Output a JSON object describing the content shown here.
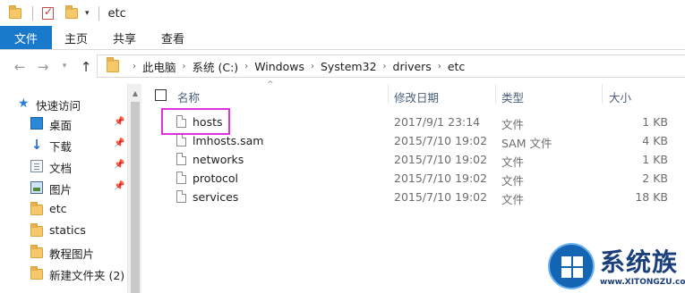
{
  "window": {
    "title": "etc"
  },
  "ribbon": {
    "tabs": [
      {
        "label": "文件"
      },
      {
        "label": "主页"
      },
      {
        "label": "共享"
      },
      {
        "label": "查看"
      }
    ]
  },
  "address": {
    "crumbs": [
      "此电脑",
      "系统 (C:)",
      "Windows",
      "System32",
      "drivers",
      "etc"
    ]
  },
  "nav": {
    "quick_access": "快速访问",
    "items": [
      {
        "label": "桌面",
        "icon": "desktop-icon",
        "pinned": true
      },
      {
        "label": "下载",
        "icon": "download-icon",
        "pinned": true
      },
      {
        "label": "文档",
        "icon": "document-icon",
        "pinned": true
      },
      {
        "label": "图片",
        "icon": "picture-icon",
        "pinned": true
      },
      {
        "label": "etc",
        "icon": "folder-icon",
        "pinned": false
      },
      {
        "label": "statics",
        "icon": "folder-icon",
        "pinned": false
      },
      {
        "label": "教程图片",
        "icon": "folder-icon",
        "pinned": false
      },
      {
        "label": "新建文件夹 (2)",
        "icon": "folder-icon",
        "pinned": false
      }
    ]
  },
  "columns": {
    "name": "名称",
    "modified": "修改日期",
    "type": "类型",
    "size": "大小"
  },
  "files": [
    {
      "name": "hosts",
      "modified": "2017/9/1 23:14",
      "type": "文件",
      "size": "1 KB",
      "highlighted": true
    },
    {
      "name": "lmhosts.sam",
      "modified": "2015/7/10 19:02",
      "type": "SAM 文件",
      "size": "4 KB"
    },
    {
      "name": "networks",
      "modified": "2015/7/10 19:02",
      "type": "文件",
      "size": "1 KB"
    },
    {
      "name": "protocol",
      "modified": "2015/7/10 19:02",
      "type": "文件",
      "size": "2 KB"
    },
    {
      "name": "services",
      "modified": "2015/7/10 19:02",
      "type": "文件",
      "size": "18 KB"
    }
  ],
  "watermark": {
    "brand": "系统族",
    "url": "www.XITONGZU.com"
  },
  "colors": {
    "ribbon_file_tab": "#1979ca",
    "highlight_box": "#e030d8"
  }
}
